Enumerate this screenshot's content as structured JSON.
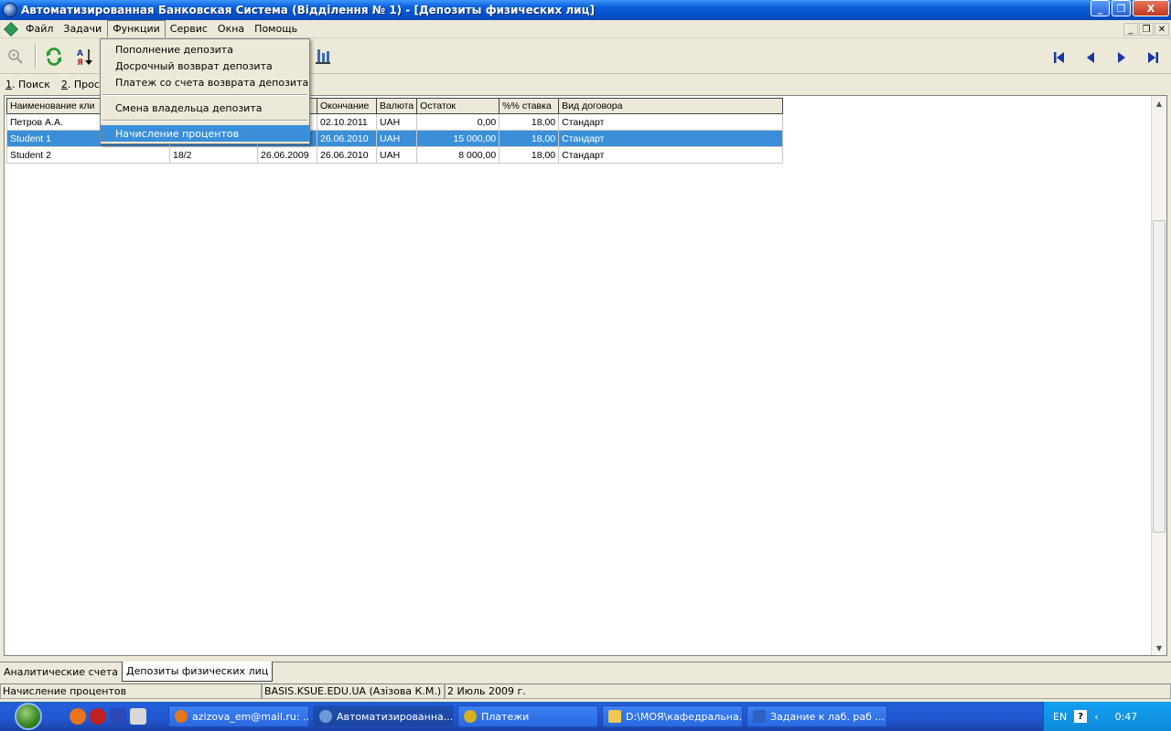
{
  "window": {
    "title": "Автоматизированная Банковская Система (Відділення № 1) - [Депозиты физических лиц]",
    "minimize": "_",
    "maximize": "❐",
    "close": "X"
  },
  "menu": {
    "items": [
      "Файл",
      "Задачи",
      "Функции",
      "Сервис",
      "Окна",
      "Помощь"
    ],
    "open_item": "Функции"
  },
  "dropdown": {
    "items": [
      "Пополнение депозита",
      "Досрочный возврат депозита",
      "Платеж со счета возврата депозита",
      "Смена владельца депозита",
      "Начисление процентов"
    ],
    "highlighted": "Начисление процентов"
  },
  "query_tabs": [
    {
      "accel": "1",
      "label": ". Поиск"
    },
    {
      "accel": "2",
      "label": ". Просм"
    }
  ],
  "grid": {
    "columns": [
      "Наименование кли",
      "",
      "",
      "Окончание",
      "Валюта",
      "Остаток",
      "%% ставка",
      "Вид договора"
    ],
    "rows": [
      [
        "Петров А.А.",
        "",
        "",
        "02.10.2011",
        "UAH",
        "0,00",
        "18,00",
        "Стандарт"
      ],
      [
        "Student 1",
        "",
        "",
        "26.06.2010",
        "UAH",
        "15 000,00",
        "18,00",
        "Стандарт"
      ],
      [
        "Student 2",
        "18/2",
        "26.06.2009",
        "26.06.2010",
        "UAH",
        "8 000,00",
        "18,00",
        "Стандарт"
      ]
    ],
    "selected_row": 1
  },
  "doc_tabs": [
    "Аналитические счета",
    "Депозиты физических лиц"
  ],
  "status": {
    "action": "Начисление процентов",
    "user": "BASIS.KSUE.EDU.UA (Азізова К.М.)",
    "date": "2 Июль 2009 г."
  },
  "taskbar": {
    "tasks": [
      {
        "label": "azizova_em@mail.ru: ...",
        "icon": "firefox-icon",
        "color": "#e8741c"
      },
      {
        "label": "Автоматизированна...",
        "icon": "bank-app-icon",
        "color": "#6c9ad8"
      },
      {
        "label": "Платежи",
        "icon": "payments-icon",
        "color": "#d8b020"
      },
      {
        "label": "D:\\МОЯ\\кафедральна...",
        "icon": "folder-icon",
        "color": "#f0c850"
      },
      {
        "label": "Задание к лаб. раб ...",
        "icon": "word-icon",
        "color": "#3060c0"
      }
    ],
    "active_index": 1,
    "lang": "EN",
    "clock": "0:47"
  },
  "colors": {
    "selection": "#3a8fd8",
    "titlebar": "#0a5fd8",
    "taskbar": "#245edc"
  }
}
